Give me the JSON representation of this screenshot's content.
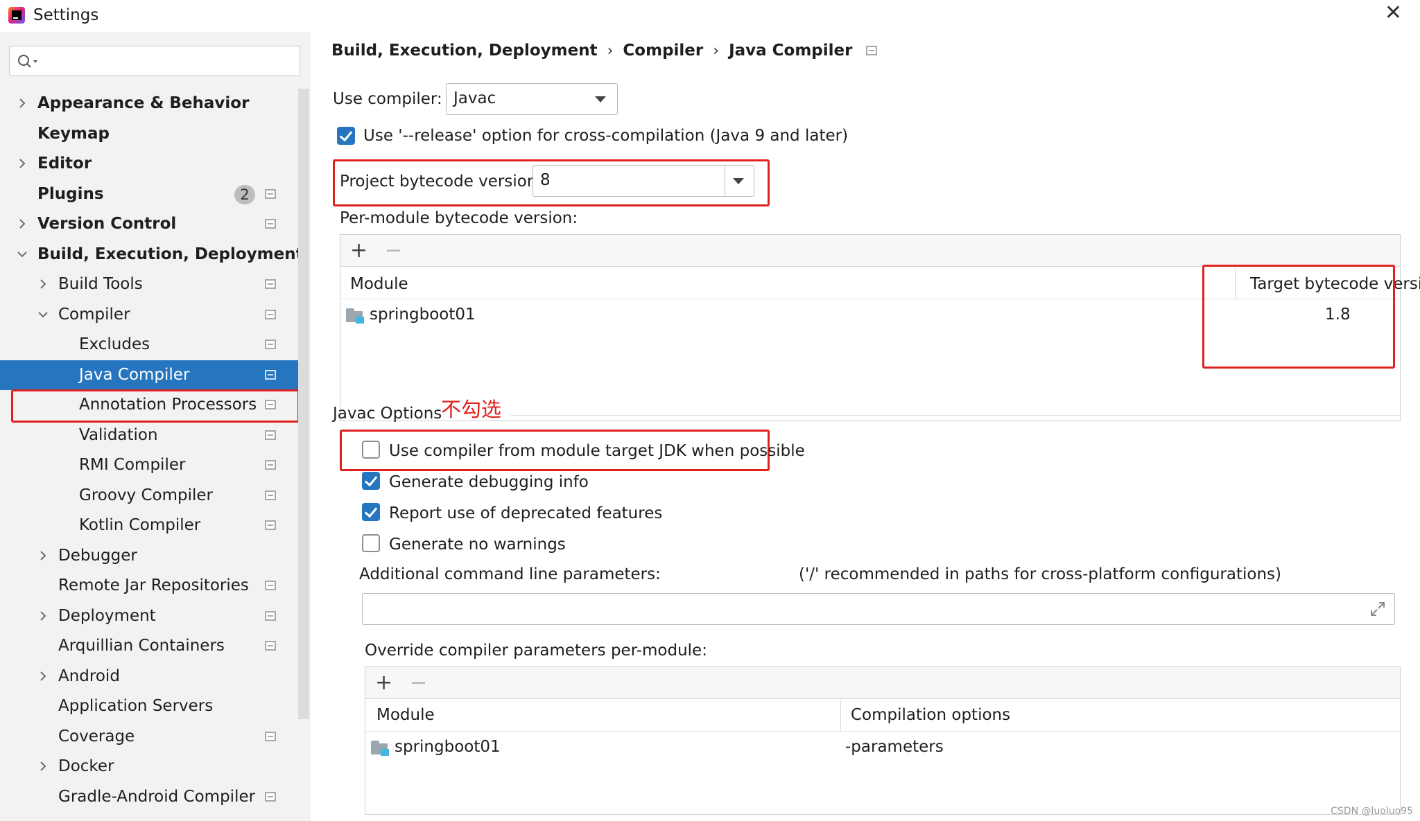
{
  "window": {
    "title": "Settings",
    "close_glyph": "✕"
  },
  "search": {
    "placeholder": "",
    "value": ""
  },
  "sidebar": {
    "items": [
      {
        "label": "Appearance & Behavior",
        "bold": true,
        "arrow": "right",
        "indent": 0,
        "proj_icon": false
      },
      {
        "label": "Keymap",
        "bold": true,
        "arrow": "none",
        "indent": 0,
        "proj_icon": false
      },
      {
        "label": "Editor",
        "bold": true,
        "arrow": "right",
        "indent": 0,
        "proj_icon": false
      },
      {
        "label": "Plugins",
        "bold": true,
        "arrow": "none",
        "indent": 0,
        "proj_icon": true,
        "badge": "2"
      },
      {
        "label": "Version Control",
        "bold": true,
        "arrow": "right",
        "indent": 0,
        "proj_icon": true
      },
      {
        "label": "Build, Execution, Deployment",
        "bold": true,
        "arrow": "down",
        "indent": 0,
        "proj_icon": false
      },
      {
        "label": "Build Tools",
        "bold": false,
        "arrow": "right",
        "indent": 1,
        "proj_icon": true
      },
      {
        "label": "Compiler",
        "bold": false,
        "arrow": "down",
        "indent": 1,
        "proj_icon": true
      },
      {
        "label": "Excludes",
        "bold": false,
        "arrow": "none",
        "indent": 2,
        "proj_icon": true
      },
      {
        "label": "Java Compiler",
        "bold": false,
        "arrow": "none",
        "indent": 2,
        "proj_icon": true,
        "selected": true
      },
      {
        "label": "Annotation Processors",
        "bold": false,
        "arrow": "none",
        "indent": 2,
        "proj_icon": true
      },
      {
        "label": "Validation",
        "bold": false,
        "arrow": "none",
        "indent": 2,
        "proj_icon": true
      },
      {
        "label": "RMI Compiler",
        "bold": false,
        "arrow": "none",
        "indent": 2,
        "proj_icon": true
      },
      {
        "label": "Groovy Compiler",
        "bold": false,
        "arrow": "none",
        "indent": 2,
        "proj_icon": true
      },
      {
        "label": "Kotlin Compiler",
        "bold": false,
        "arrow": "none",
        "indent": 2,
        "proj_icon": true
      },
      {
        "label": "Debugger",
        "bold": false,
        "arrow": "right",
        "indent": 1,
        "proj_icon": false
      },
      {
        "label": "Remote Jar Repositories",
        "bold": false,
        "arrow": "none",
        "indent": 1,
        "proj_icon": true
      },
      {
        "label": "Deployment",
        "bold": false,
        "arrow": "right",
        "indent": 1,
        "proj_icon": true
      },
      {
        "label": "Arquillian Containers",
        "bold": false,
        "arrow": "none",
        "indent": 1,
        "proj_icon": true
      },
      {
        "label": "Android",
        "bold": false,
        "arrow": "right",
        "indent": 1,
        "proj_icon": false
      },
      {
        "label": "Application Servers",
        "bold": false,
        "arrow": "none",
        "indent": 1,
        "proj_icon": false
      },
      {
        "label": "Coverage",
        "bold": false,
        "arrow": "none",
        "indent": 1,
        "proj_icon": true
      },
      {
        "label": "Docker",
        "bold": false,
        "arrow": "right",
        "indent": 1,
        "proj_icon": false
      },
      {
        "label": "Gradle-Android Compiler",
        "bold": false,
        "arrow": "none",
        "indent": 1,
        "proj_icon": true
      }
    ]
  },
  "breadcrumb": {
    "parts": [
      "Build, Execution, Deployment",
      "Compiler",
      "Java Compiler"
    ],
    "sep": "›"
  },
  "compiler": {
    "use_compiler_label": "Use compiler:",
    "use_compiler_value": "Javac",
    "release_option_label": "Use '--release' option for cross-compilation (Java 9 and later)",
    "release_option_checked": true,
    "bytecode_label": "Project bytecode version:",
    "bytecode_value": "8",
    "per_module_label": "Per-module bytecode version:",
    "per_module_table": {
      "columns": [
        "Module",
        "Target bytecode version"
      ],
      "rows": [
        {
          "module": "springboot01",
          "version": "1.8"
        }
      ]
    }
  },
  "javac": {
    "section_label": "Javac Options",
    "annotation": "不勾选",
    "options": [
      {
        "label": "Use compiler from module target JDK when possible",
        "checked": false
      },
      {
        "label": "Generate debugging info",
        "checked": true
      },
      {
        "label": "Report use of deprecated features",
        "checked": true
      },
      {
        "label": "Generate no warnings",
        "checked": false
      }
    ],
    "additional_params_label": "Additional command line parameters:",
    "additional_params_hint": "('/' recommended in paths for cross-platform configurations)",
    "additional_params_value": "",
    "override_label": "Override compiler parameters per-module:",
    "override_table": {
      "columns": [
        "Module",
        "Compilation options"
      ],
      "rows": [
        {
          "module": "springboot01",
          "options": "-parameters"
        }
      ]
    }
  },
  "toolbar": {
    "add_glyph": "+",
    "remove_glyph": "−"
  },
  "watermark": "CSDN @luoluo95",
  "colors": {
    "accent": "#2675bf",
    "highlight_red": "#e0201d",
    "sidebar_bg": "#f2f2f2"
  }
}
